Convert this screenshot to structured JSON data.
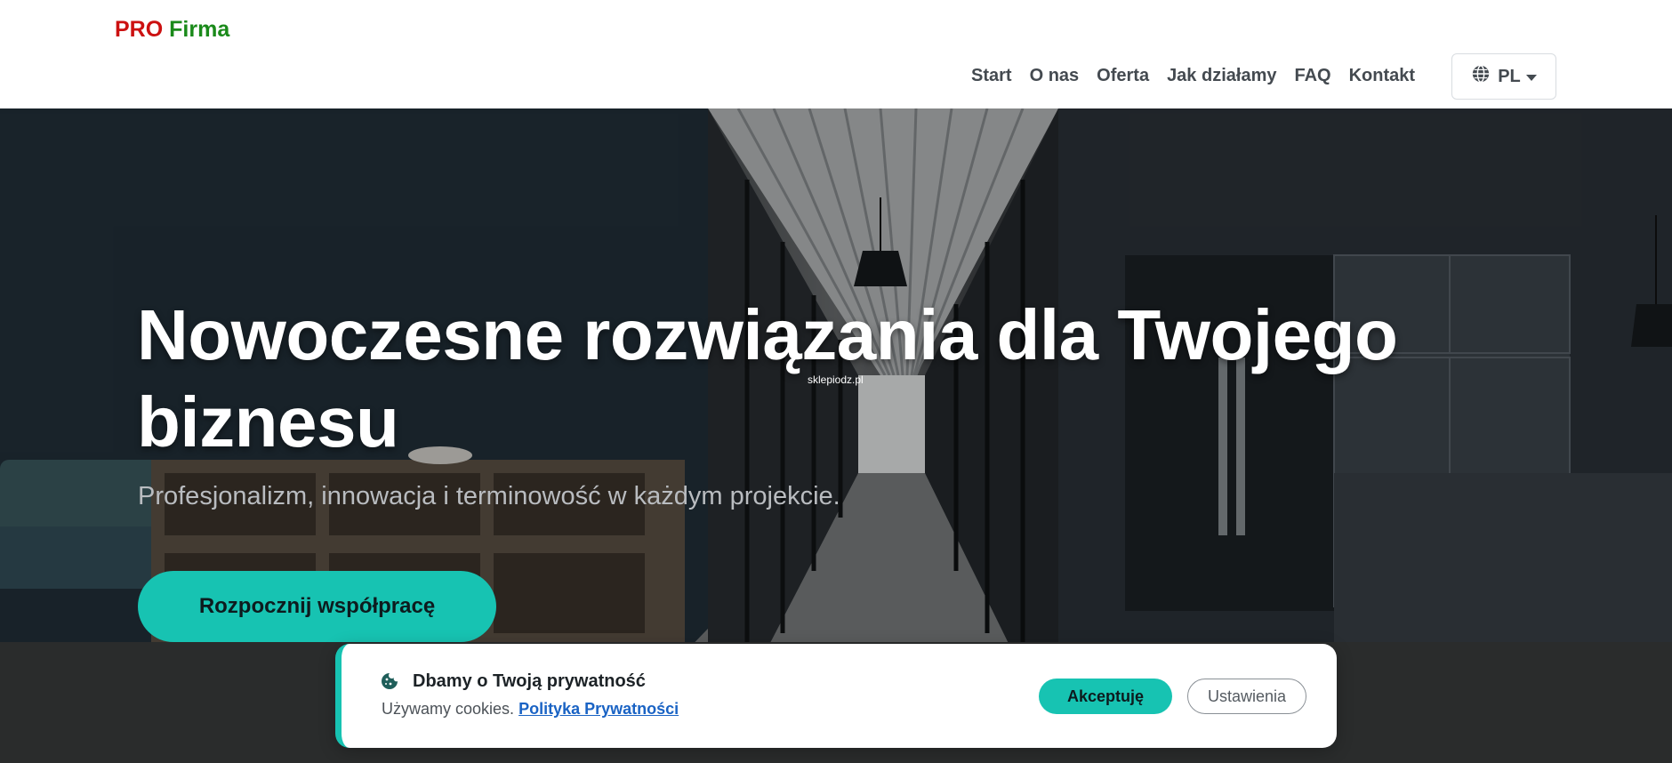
{
  "header": {
    "logo_part1": "PRO",
    "logo_part2": "Firma",
    "nav": [
      "Start",
      "O nas",
      "Oferta",
      "Jak działamy",
      "FAQ",
      "Kontakt"
    ],
    "language": "PL"
  },
  "hero": {
    "title_line1": "Nowoczesne rozwiązania dla Twojego",
    "title_line2": "biznesu",
    "watermark": "sklepiodz.pl",
    "subtitle": "Profesjonalizm, innowacja i terminowość w każdym projekcie.",
    "cta_label": "Rozpocznij współpracę"
  },
  "cookie": {
    "title": "Dbamy o Twoją prywatność",
    "text": "Używamy cookies.",
    "link": "Polityka Prywatności",
    "accept_label": "Akceptuję",
    "settings_label": "Ustawienia"
  },
  "colors": {
    "accent": "#17c3b2",
    "logo_red": "#cc1111",
    "logo_green": "#1a8a1a",
    "link_blue": "#1a63c4"
  }
}
